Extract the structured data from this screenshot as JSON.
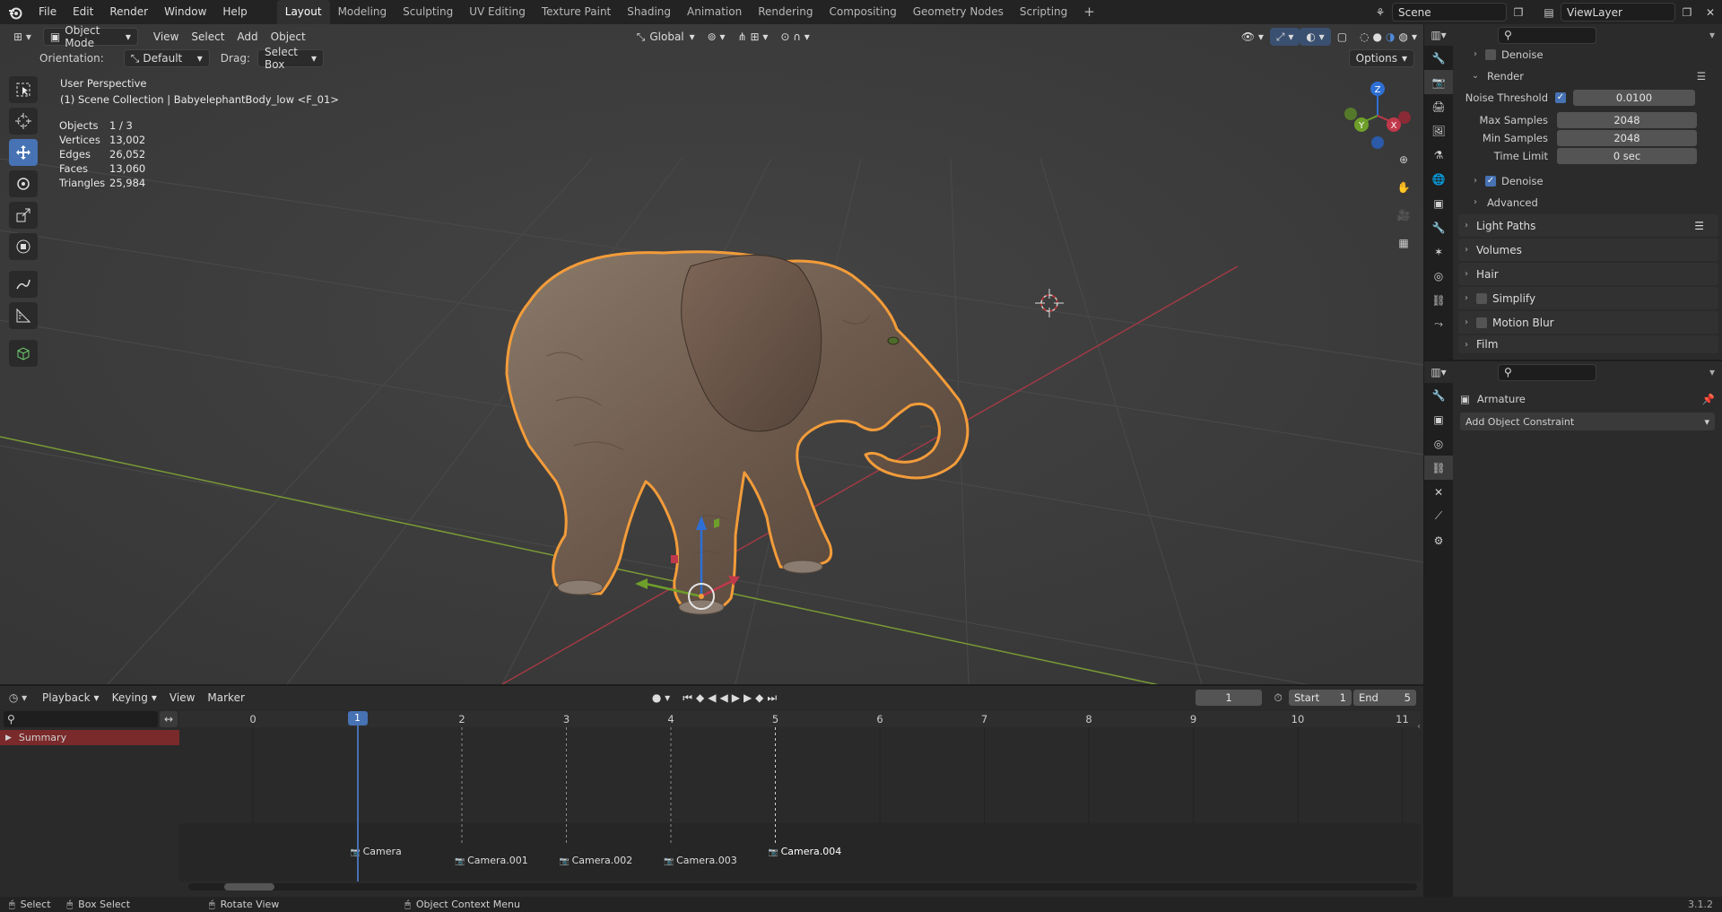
{
  "topbar": {
    "menus": [
      "File",
      "Edit",
      "Render",
      "Window",
      "Help"
    ],
    "workspaces": [
      "Layout",
      "Modeling",
      "Sculpting",
      "UV Editing",
      "Texture Paint",
      "Shading",
      "Animation",
      "Rendering",
      "Compositing",
      "Geometry Nodes",
      "Scripting"
    ],
    "active_workspace": "Layout",
    "add_tab": "+",
    "scene": "Scene",
    "view_layer": "ViewLayer"
  },
  "viewport_header": {
    "mode": "Object Mode",
    "menus": [
      "View",
      "Select",
      "Add",
      "Object"
    ],
    "transform_orientation": "Global",
    "orientation_label": "Orientation:",
    "orientation_value": "Default",
    "drag_label": "Drag:",
    "drag_value": "Select Box",
    "options": "Options"
  },
  "overlay": {
    "perspective": "User Perspective",
    "collection": "(1) Scene Collection | BabyelephantBody_low <F_01>",
    "stats": [
      {
        "label": "Objects",
        "value": "1 / 3"
      },
      {
        "label": "Vertices",
        "value": "13,002"
      },
      {
        "label": "Edges",
        "value": "26,052"
      },
      {
        "label": "Faces",
        "value": "13,060"
      },
      {
        "label": "Triangles",
        "value": "25,984"
      }
    ]
  },
  "gizmo": {
    "z": "Z",
    "y": "Y",
    "x": "X"
  },
  "properties": {
    "search_placeholder": "",
    "denoise_top": "Denoise",
    "render_section": "Render",
    "noise_threshold_label": "Noise Threshold",
    "noise_threshold": "0.0100",
    "max_samples_label": "Max Samples",
    "max_samples": "2048",
    "min_samples_label": "Min Samples",
    "min_samples": "2048",
    "time_limit_label": "Time Limit",
    "time_limit": "0 sec",
    "denoise": "Denoise",
    "advanced": "Advanced",
    "light_paths": "Light Paths",
    "volumes": "Volumes",
    "hair": "Hair",
    "simplify": "Simplify",
    "motion_blur": "Motion Blur",
    "film": "Film"
  },
  "constraints": {
    "object_name": "Armature",
    "add_constraint": "Add Object Constraint"
  },
  "timeline": {
    "menus": [
      "Playback",
      "Keying",
      "View",
      "Marker"
    ],
    "current_frame": "1",
    "start_label": "Start",
    "start": "1",
    "end_label": "End",
    "end": "5",
    "ticks": [
      "0",
      "1",
      "2",
      "3",
      "4",
      "5",
      "6",
      "7",
      "8",
      "9",
      "10",
      "11"
    ],
    "summary": "Summary",
    "markers": [
      "Camera",
      "Camera.001",
      "Camera.002",
      "Camera.003",
      "Camera.004"
    ],
    "playhead_frame": 1
  },
  "status": {
    "select": "Select",
    "box_select": "Box Select",
    "rotate_view": "Rotate View",
    "context_menu": "Object Context Menu",
    "version": "3.1.2"
  },
  "colors": {
    "accent": "#4772b3",
    "selection": "#f39c3a",
    "x_axis": "#c0394b",
    "y_axis": "#6e9f2a",
    "z_axis": "#2f6fd4"
  }
}
